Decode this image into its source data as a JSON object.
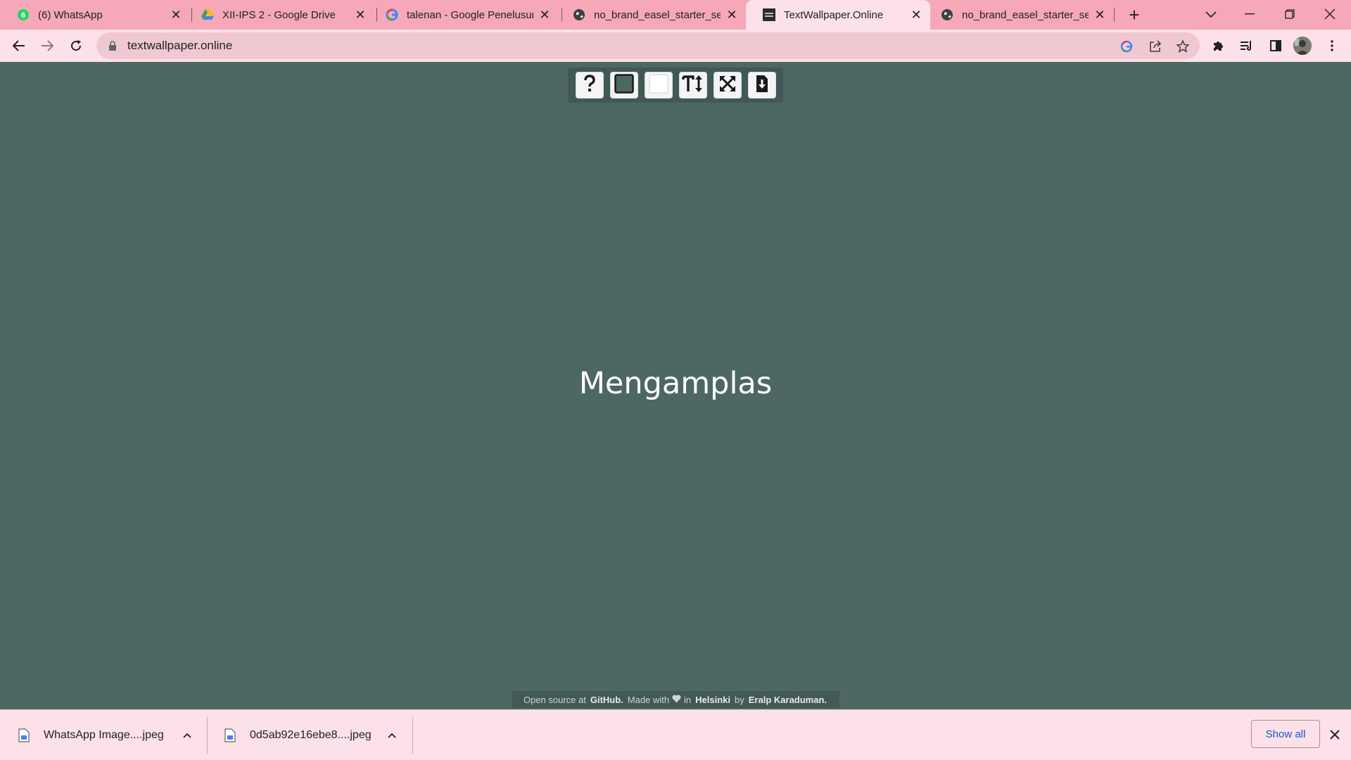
{
  "browser": {
    "tabs": [
      {
        "title": "(6) WhatsApp",
        "icon": "whatsapp-icon"
      },
      {
        "title": "XII-IPS 2 - Google Drive",
        "icon": "google-drive-icon"
      },
      {
        "title": "talenan - Google Penelusuran",
        "icon": "google-icon"
      },
      {
        "title": "no_brand_easel_starter_set_",
        "icon": "globe-icon"
      },
      {
        "title": "TextWallpaper.Online",
        "icon": "textwallpaper-icon",
        "active": true
      },
      {
        "title": "no_brand_easel_starter_set_",
        "icon": "globe-icon"
      }
    ],
    "tab_close_glyph": "✕",
    "new_tab_glyph": "+",
    "url": "textwallpaper.online"
  },
  "page": {
    "wallpaper_text": "Mengamplas",
    "background_color": "#4d6762",
    "text_color": "#ffffff",
    "toolbar_tools": [
      "help-icon",
      "background-color-swatch",
      "text-color-swatch",
      "font-size-icon",
      "fullscreen-icon",
      "download-icon"
    ],
    "credits": {
      "prefix": "Open source at",
      "github": "GitHub.",
      "made_with": "Made with",
      "in": "in",
      "city": "Helsinki",
      "by": "by",
      "author": "Eralp Karaduman."
    }
  },
  "downloads": {
    "items": [
      {
        "name": "WhatsApp Image....jpeg"
      },
      {
        "name": "0d5ab92e16ebe8....jpeg"
      }
    ],
    "show_all": "Show all"
  }
}
